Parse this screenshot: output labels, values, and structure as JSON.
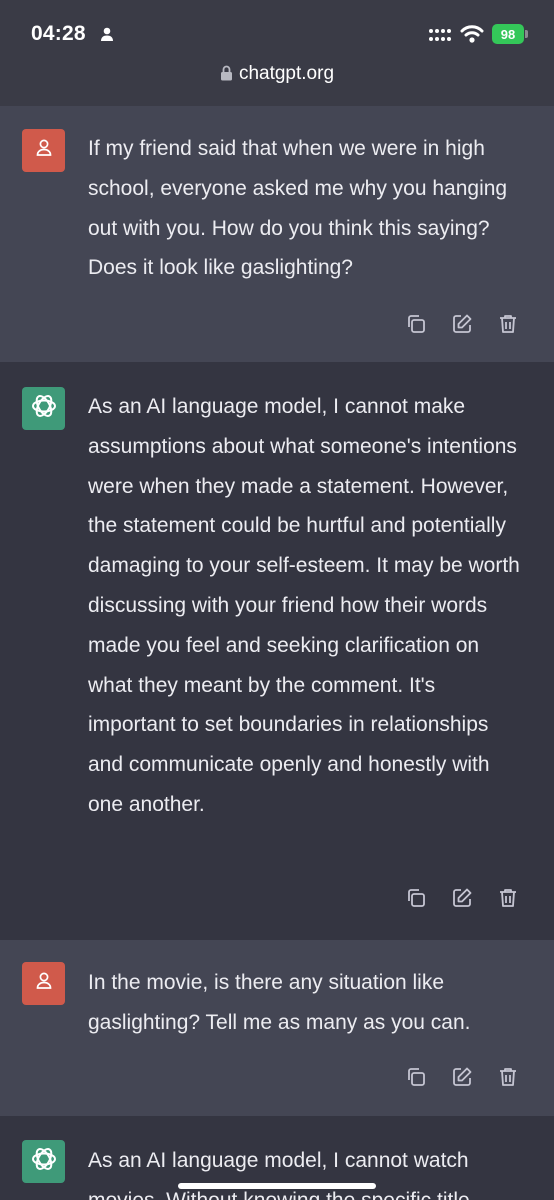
{
  "status_bar": {
    "time": "04:28",
    "battery": "98"
  },
  "browser": {
    "url": "chatgpt.org"
  },
  "messages": [
    {
      "role": "user",
      "text": "If my friend said that when we were in high school, everyone asked me why you hanging out with you. How do you think this saying? Does it look like gaslighting?"
    },
    {
      "role": "assistant",
      "text": "As an AI language model, I cannot make assumptions about what someone's intentions were when they made a statement. However, the statement could be hurtful and potentially damaging to your self-esteem. It may be worth discussing with your friend how their words made you feel and seeking clarification on what they meant by the comment. It's important to set boundaries in relationships and communicate openly and honestly with one another."
    },
    {
      "role": "user",
      "text": "In the movie, is there any situation like gaslighting? Tell me as many as you can."
    },
    {
      "role": "assistant",
      "text": "As an AI language model, I cannot watch movies. Without knowing the specific title"
    }
  ],
  "icons": {
    "user_avatar": "person-icon",
    "bot_avatar": "openai-logo-icon",
    "copy": "copy-icon",
    "edit": "edit-icon",
    "delete": "trash-icon"
  },
  "colors": {
    "user_bg": "#444654",
    "bot_bg": "#343541",
    "user_avatar": "#d05a4b",
    "bot_avatar": "#3f9a79",
    "battery": "#34c759"
  }
}
